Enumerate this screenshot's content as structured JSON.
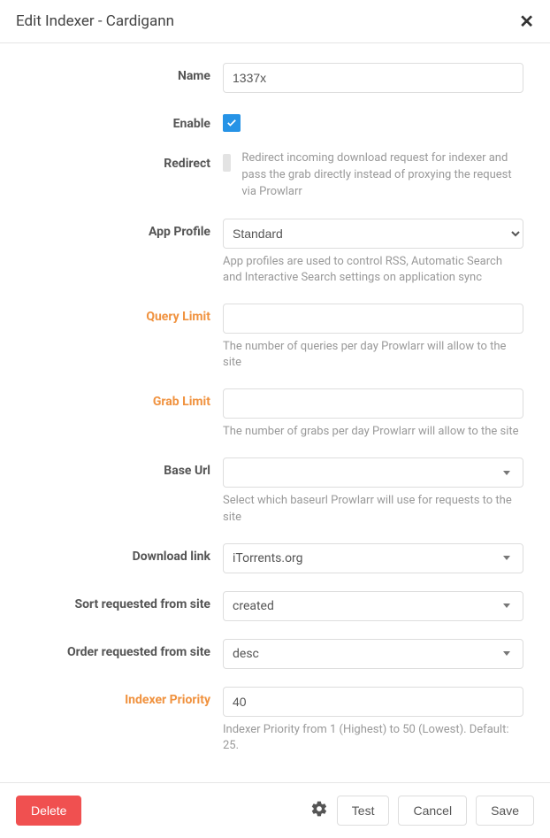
{
  "header": {
    "title": "Edit Indexer - Cardigann"
  },
  "fields": {
    "name": {
      "label": "Name",
      "value": "1337x"
    },
    "enable": {
      "label": "Enable",
      "checked": true
    },
    "redirect": {
      "label": "Redirect",
      "checked": false,
      "help": "Redirect incoming download request for indexer and pass the grab directly instead of proxying the request via Prowlarr"
    },
    "appProfile": {
      "label": "App Profile",
      "value": "Standard",
      "help": "App profiles are used to control RSS, Automatic Search and Interactive Search settings on application sync"
    },
    "queryLimit": {
      "label": "Query Limit",
      "value": "",
      "help": "The number of queries per day Prowlarr will allow to the site"
    },
    "grabLimit": {
      "label": "Grab Limit",
      "value": "",
      "help": "The number of grabs per day Prowlarr will allow to the site"
    },
    "baseUrl": {
      "label": "Base Url",
      "value": "",
      "help": "Select which baseurl Prowlarr will use for requests to the site"
    },
    "downloadLink": {
      "label": "Download link",
      "value": "iTorrents.org"
    },
    "sort": {
      "label": "Sort requested from site",
      "value": "created"
    },
    "order": {
      "label": "Order requested from site",
      "value": "desc"
    },
    "priority": {
      "label": "Indexer Priority",
      "value": "40",
      "help": "Indexer Priority from 1 (Highest) to 50 (Lowest). Default: 25."
    }
  },
  "footer": {
    "delete": "Delete",
    "test": "Test",
    "cancel": "Cancel",
    "save": "Save"
  }
}
